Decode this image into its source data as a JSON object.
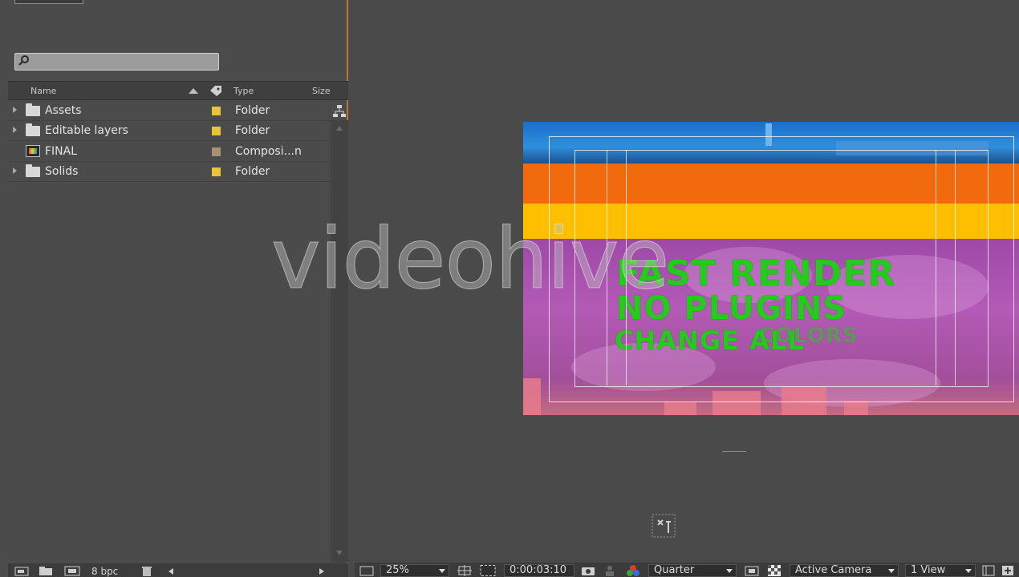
{
  "project": {
    "columns": {
      "name": "Name",
      "type": "Type",
      "size": "Size"
    },
    "items": [
      {
        "name": "Assets",
        "type": "Folder",
        "kind": "folder",
        "label_color": "#e6c53a"
      },
      {
        "name": "Editable layers",
        "type": "Folder",
        "kind": "folder",
        "label_color": "#e6c53a"
      },
      {
        "name": "FINAL",
        "type": "Composi...n",
        "kind": "composition",
        "label_color": "#a89274"
      },
      {
        "name": "Solids",
        "type": "Folder",
        "kind": "folder",
        "label_color": "#e6c53a"
      }
    ],
    "bit_depth": "8 bpc"
  },
  "viewer": {
    "watermark": "videohive",
    "promo_lines": [
      "FAST RENDER",
      "NO PLUGINS",
      "CHANGE ALL",
      "COLORS"
    ],
    "toolbar": {
      "zoom": "25%",
      "timecode": "0:00:03:10",
      "resolution": "Quarter",
      "camera": "Active Camera",
      "views": "1 View"
    }
  },
  "colors": {
    "accent_border": "#b9782a",
    "text_green": "#27c81f",
    "band_orange": "#f26a0e",
    "band_yellow": "#fdbf00"
  }
}
